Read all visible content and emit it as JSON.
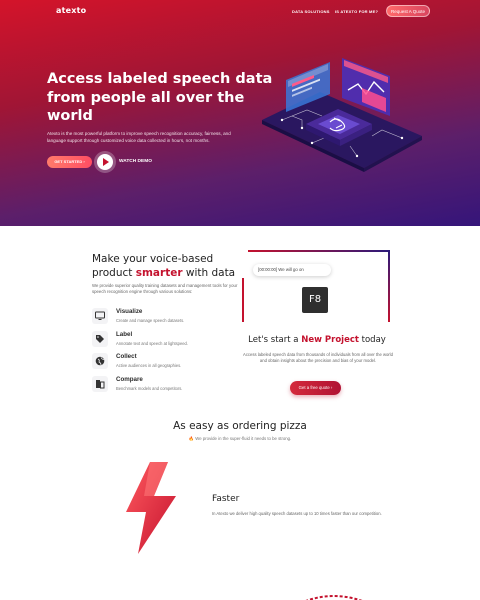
{
  "nav": {
    "logo": "atexto",
    "links": [
      "DATA SOLUTIONS",
      "IS ATEXTO FOR ME?"
    ],
    "cta": "Request A Quote"
  },
  "hero": {
    "title": "Access labeled speech data from people all over the world",
    "description": "Atexto is the most powerful platform to improve speech recognition accuracy, fairness, and language support through customized voice data collected in hours, not months.",
    "start_button": "GET STARTED ›",
    "demo_label": "WATCH DEMO"
  },
  "features_section": {
    "title_prefix": "Make your voice-based product ",
    "title_accent": "smarter",
    "title_suffix": " with data",
    "description": "We provide superior quality training datasets and management tools for your speech recognition engine through various solutions:",
    "items": [
      {
        "title": "Visualize",
        "text": "Create and manage speech datasets.",
        "icon": "monitor-icon"
      },
      {
        "title": "Label",
        "text": "Annotate text and speech at lightspeed.",
        "icon": "tag-icon"
      },
      {
        "title": "Collect",
        "text": "Active audiences in all geographies.",
        "icon": "globe-icon"
      },
      {
        "title": "Compare",
        "text": "Benchmark models and competitors.",
        "icon": "compare-icon"
      }
    ]
  },
  "project_card": {
    "chat_text": "[00:00:00] We will go on",
    "key_label": "F8",
    "title_prefix": "Let's start a ",
    "title_accent": "New Project",
    "title_suffix": " today",
    "description": "Access labeled speech data from thousands of individuals from all over the world and obtain insights about the precision and bias of your model.",
    "button": "Get a free quote ›"
  },
  "pizza_section": {
    "title": "As easy as ordering pizza",
    "subtitle": "We provide in the super-fluid it needs to be strong."
  },
  "faster": {
    "title": "Faster",
    "description": "In Atexto we deliver high quality speech datasets up to 10 times faster than our competition."
  },
  "colors": {
    "accent": "#c4122e",
    "hero_start": "#d4142a",
    "hero_end": "#35157a"
  }
}
